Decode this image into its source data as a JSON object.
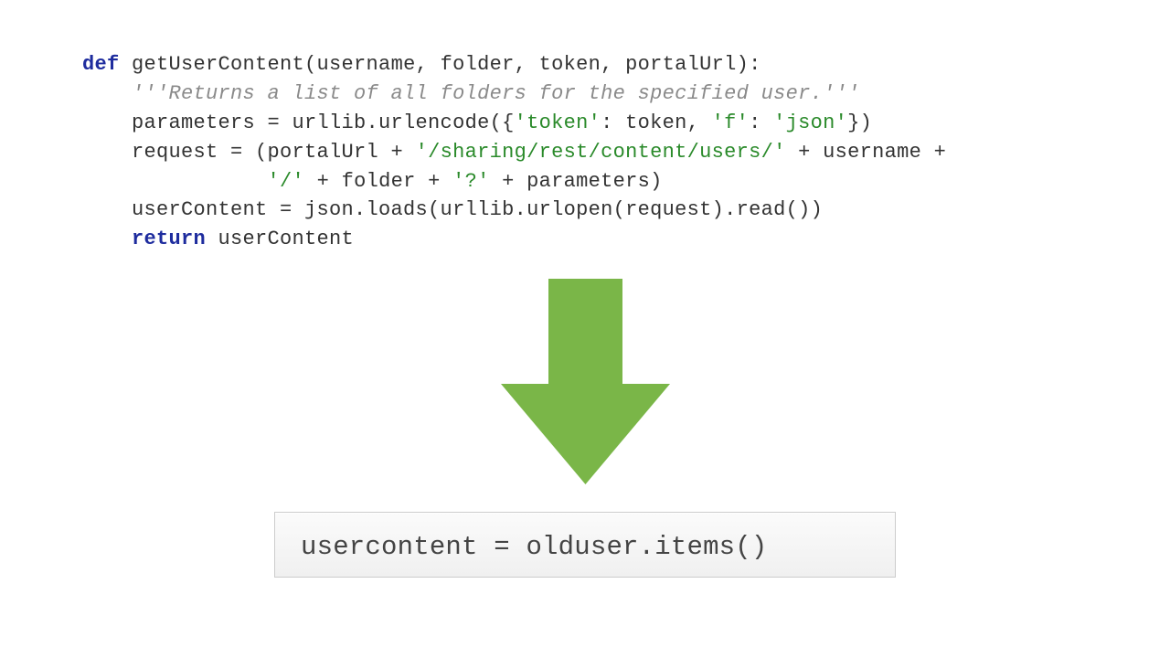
{
  "arrow_color": "#7ab648",
  "top_code": {
    "l1_def": "def",
    "l1_rest": " getUserContent(username, folder, token, portalUrl):",
    "l2_doc": "    '''Returns a list of all folders for the specified user.'''",
    "l3_a": "    parameters = urllib.urlencode({",
    "l3_s1": "'token'",
    "l3_b": ": token, ",
    "l3_s2": "'f'",
    "l3_c": ": ",
    "l3_s3": "'json'",
    "l3_d": "})",
    "l4_a": "    request = (portalUrl + ",
    "l4_s1": "'/sharing/rest/content/users/'",
    "l4_b": " + username +",
    "l5_a": "               ",
    "l5_s1": "'/'",
    "l5_b": " + folder + ",
    "l5_s2": "'?'",
    "l5_c": " + parameters)",
    "l6": "    userContent = json.loads(urllib.urlopen(request).read())",
    "l7_ret": "    return",
    "l7_rest": " userContent"
  },
  "bottom_code": "usercontent = olduser.items()"
}
